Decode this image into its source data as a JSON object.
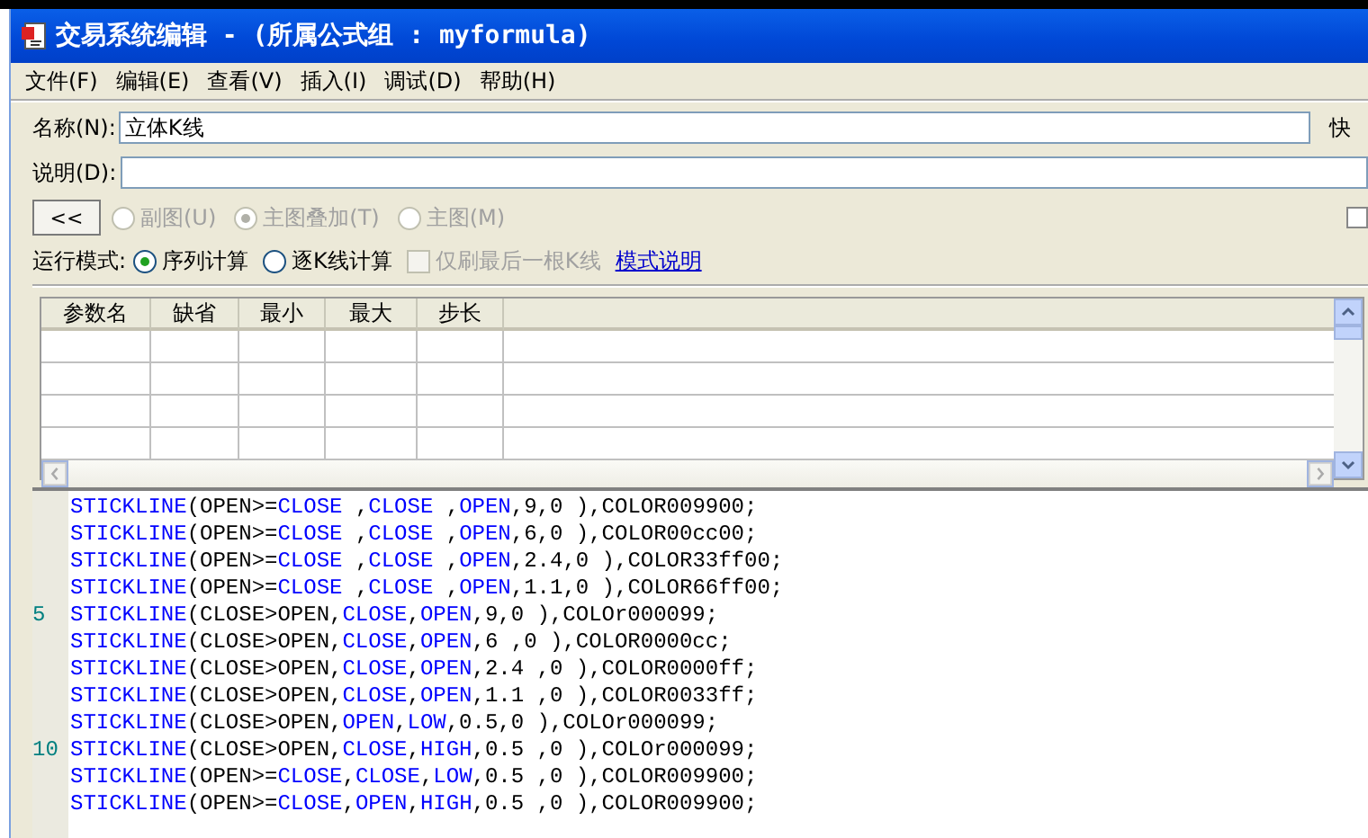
{
  "window": {
    "title": "交易系统编辑 - (所属公式组 : myformula)"
  },
  "menu": [
    "文件(F)",
    "编辑(E)",
    "查看(V)",
    "插入(I)",
    "调试(D)",
    "帮助(H)"
  ],
  "name_field": {
    "label": "名称(N):",
    "value": "立体K线"
  },
  "shortcut_label": "快",
  "description_field": {
    "label": "说明(D):"
  },
  "collapse_button": "<<",
  "chart_type": [
    {
      "label": "副图(U)",
      "selected": false,
      "disabled": true
    },
    {
      "label": "主图叠加(T)",
      "selected": true,
      "disabled": true
    },
    {
      "label": "主图(M)",
      "selected": false,
      "disabled": true
    }
  ],
  "run_mode": {
    "label": "运行模式:",
    "options": [
      {
        "label": "序列计算",
        "selected": true
      },
      {
        "label": "逐K线计算",
        "selected": false
      }
    ],
    "refresh_last": {
      "label": "仅刷最后一根K线",
      "checked": false,
      "disabled": true
    },
    "help_link": "模式说明"
  },
  "params_table": {
    "columns": [
      "参数名",
      "缺省",
      "最小",
      "最大",
      "步长"
    ]
  },
  "side_checkbox": {
    "checked": false
  },
  "code": [
    {
      "tokens": [
        {
          "kind": "keyword",
          "text": "STICKLINE"
        },
        {
          "kind": "plain",
          "text": "(OPEN>="
        },
        {
          "kind": "keyword",
          "text": "CLOSE"
        },
        {
          "kind": "plain",
          "text": " ,"
        },
        {
          "kind": "keyword",
          "text": "CLOSE"
        },
        {
          "kind": "plain",
          "text": " ,"
        },
        {
          "kind": "keyword",
          "text": "OPEN"
        },
        {
          "kind": "plain",
          "text": ",9,0 ),COLOR009900;"
        }
      ]
    },
    {
      "tokens": [
        {
          "kind": "keyword",
          "text": "STICKLINE"
        },
        {
          "kind": "plain",
          "text": "(OPEN>="
        },
        {
          "kind": "keyword",
          "text": "CLOSE"
        },
        {
          "kind": "plain",
          "text": " ,"
        },
        {
          "kind": "keyword",
          "text": "CLOSE"
        },
        {
          "kind": "plain",
          "text": " ,"
        },
        {
          "kind": "keyword",
          "text": "OPEN"
        },
        {
          "kind": "plain",
          "text": ",6,0 ),COLOR00cc00;"
        }
      ]
    },
    {
      "tokens": [
        {
          "kind": "keyword",
          "text": "STICKLINE"
        },
        {
          "kind": "plain",
          "text": "(OPEN>="
        },
        {
          "kind": "keyword",
          "text": "CLOSE"
        },
        {
          "kind": "plain",
          "text": " ,"
        },
        {
          "kind": "keyword",
          "text": "CLOSE"
        },
        {
          "kind": "plain",
          "text": " ,"
        },
        {
          "kind": "keyword",
          "text": "OPEN"
        },
        {
          "kind": "plain",
          "text": ",2.4,0 ),COLOR33ff00;"
        }
      ]
    },
    {
      "tokens": [
        {
          "kind": "keyword",
          "text": "STICKLINE"
        },
        {
          "kind": "plain",
          "text": "(OPEN>="
        },
        {
          "kind": "keyword",
          "text": "CLOSE"
        },
        {
          "kind": "plain",
          "text": " ,"
        },
        {
          "kind": "keyword",
          "text": "CLOSE"
        },
        {
          "kind": "plain",
          "text": " ,"
        },
        {
          "kind": "keyword",
          "text": "OPEN"
        },
        {
          "kind": "plain",
          "text": ",1.1,0 ),COLOR66ff00;"
        }
      ]
    },
    {
      "number": "5",
      "tokens": [
        {
          "kind": "keyword",
          "text": "STICKLINE"
        },
        {
          "kind": "plain",
          "text": "(CLOSE>OPEN,"
        },
        {
          "kind": "keyword",
          "text": "CLOSE"
        },
        {
          "kind": "plain",
          "text": ","
        },
        {
          "kind": "keyword",
          "text": "OPEN"
        },
        {
          "kind": "plain",
          "text": ",9,0 ),COLOr000099;"
        }
      ]
    },
    {
      "tokens": [
        {
          "kind": "keyword",
          "text": "STICKLINE"
        },
        {
          "kind": "plain",
          "text": "(CLOSE>OPEN,"
        },
        {
          "kind": "keyword",
          "text": "CLOSE"
        },
        {
          "kind": "plain",
          "text": ","
        },
        {
          "kind": "keyword",
          "text": "OPEN"
        },
        {
          "kind": "plain",
          "text": ",6 ,0 ),COLOR0000cc;"
        }
      ]
    },
    {
      "tokens": [
        {
          "kind": "keyword",
          "text": "STICKLINE"
        },
        {
          "kind": "plain",
          "text": "(CLOSE>OPEN,"
        },
        {
          "kind": "keyword",
          "text": "CLOSE"
        },
        {
          "kind": "plain",
          "text": ","
        },
        {
          "kind": "keyword",
          "text": "OPEN"
        },
        {
          "kind": "plain",
          "text": ",2.4 ,0 ),COLOR0000ff;"
        }
      ]
    },
    {
      "tokens": [
        {
          "kind": "keyword",
          "text": "STICKLINE"
        },
        {
          "kind": "plain",
          "text": "(CLOSE>OPEN,"
        },
        {
          "kind": "keyword",
          "text": "CLOSE"
        },
        {
          "kind": "plain",
          "text": ","
        },
        {
          "kind": "keyword",
          "text": "OPEN"
        },
        {
          "kind": "plain",
          "text": ",1.1 ,0 ),COLOR0033ff;"
        }
      ]
    },
    {
      "tokens": [
        {
          "kind": "keyword",
          "text": "STICKLINE"
        },
        {
          "kind": "plain",
          "text": "(CLOSE>OPEN,"
        },
        {
          "kind": "keyword",
          "text": "OPEN"
        },
        {
          "kind": "plain",
          "text": ","
        },
        {
          "kind": "keyword",
          "text": "LOW"
        },
        {
          "kind": "plain",
          "text": ",0.5,0 ),COLOr000099;"
        }
      ]
    },
    {
      "number": "10",
      "tokens": [
        {
          "kind": "keyword",
          "text": "STICKLINE"
        },
        {
          "kind": "plain",
          "text": "(CLOSE>OPEN,"
        },
        {
          "kind": "keyword",
          "text": "CLOSE"
        },
        {
          "kind": "plain",
          "text": ","
        },
        {
          "kind": "keyword",
          "text": "HIGH"
        },
        {
          "kind": "plain",
          "text": ",0.5 ,0 ),COLOr000099;"
        }
      ]
    },
    {
      "tokens": [
        {
          "kind": "keyword",
          "text": "STICKLINE"
        },
        {
          "kind": "plain",
          "text": "(OPEN>="
        },
        {
          "kind": "keyword",
          "text": "CLOSE"
        },
        {
          "kind": "plain",
          "text": ","
        },
        {
          "kind": "keyword",
          "text": "CLOSE"
        },
        {
          "kind": "plain",
          "text": ","
        },
        {
          "kind": "keyword",
          "text": "LOW"
        },
        {
          "kind": "plain",
          "text": ",0.5 ,0 ),COLOR009900;"
        }
      ]
    },
    {
      "tokens": [
        {
          "kind": "keyword",
          "text": "STICKLINE"
        },
        {
          "kind": "plain",
          "text": "(OPEN>="
        },
        {
          "kind": "keyword",
          "text": "CLOSE"
        },
        {
          "kind": "plain",
          "text": ","
        },
        {
          "kind": "keyword",
          "text": "OPEN"
        },
        {
          "kind": "plain",
          "text": ","
        },
        {
          "kind": "keyword",
          "text": "HIGH"
        },
        {
          "kind": "plain",
          "text": ",0.5 ,0 ),COLOR009900;"
        }
      ]
    }
  ]
}
